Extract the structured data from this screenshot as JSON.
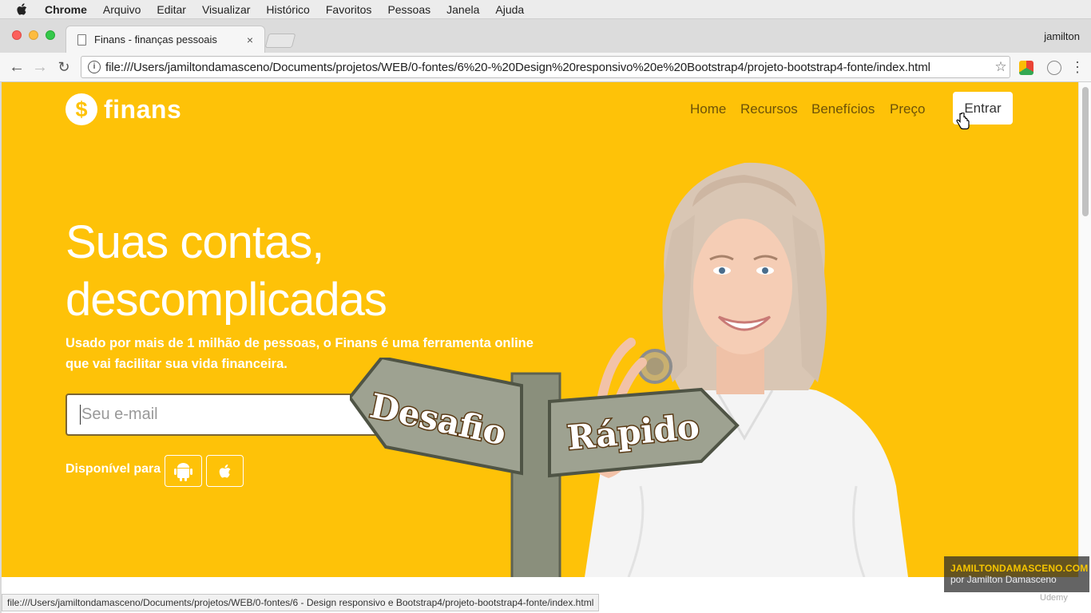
{
  "menubar": {
    "app": "Chrome",
    "items": [
      "Arquivo",
      "Editar",
      "Visualizar",
      "Histórico",
      "Favoritos",
      "Pessoas",
      "Janela",
      "Ajuda"
    ]
  },
  "browser": {
    "tab_title": "Finans - finanças pessoais",
    "tab_close": "×",
    "profile": "jamilton",
    "url": "file:///Users/jamiltondamasceno/Documents/projetos/WEB/0-fontes/6%20-%20Design%20responsivo%20e%20Bootstrap4/projeto-bootstrap4-fonte/index.html",
    "status_url": "file:///Users/jamiltondamasceno/Documents/projetos/WEB/0-fontes/6 - Design responsivo e Bootstrap4/projeto-bootstrap4-fonte/index.html"
  },
  "site": {
    "logo_symbol": "$",
    "logo_text": "finans",
    "nav": [
      "Home",
      "Recursos",
      "Benefícios",
      "Preço"
    ],
    "login_label": "Entrar",
    "headline_line1": "Suas contas,",
    "headline_line2": "descomplicadas",
    "lead": "Usado por mais de 1 milhão de pessoas, o Finans é uma ferramenta online que vai facilitar sua vida financeira.",
    "email_placeholder": "Seu e-mail",
    "available_label": "Disponível para",
    "store_icons": [
      "android-icon",
      "apple-icon"
    ]
  },
  "overlay": {
    "sign_left": "Desafio",
    "sign_right": "Rápido"
  },
  "watermark": {
    "title": "JAMILTONDAMASCENO.COM",
    "subtitle": "por Jamilton Damasceno",
    "udemy": "Udemy"
  },
  "colors": {
    "brand_yellow": "#fec208",
    "nav_text": "#6d5208"
  }
}
